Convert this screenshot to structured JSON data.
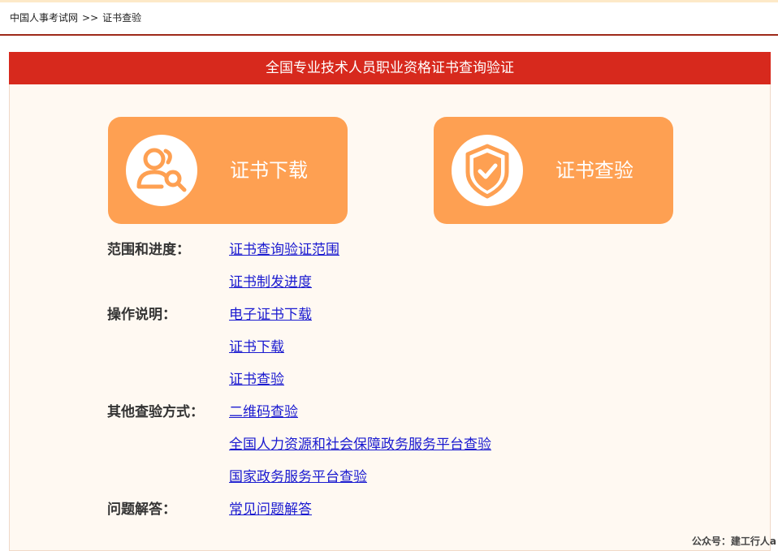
{
  "breadcrumb": {
    "home": "中国人事考试网",
    "separator": ">>",
    "current": "证书查验"
  },
  "panel": {
    "title": "全国专业技术人员职业资格证书查询验证"
  },
  "buttons": {
    "download": {
      "label": "证书下载",
      "icon": "user-search-icon"
    },
    "verify": {
      "label": "证书查验",
      "icon": "shield-check-icon"
    }
  },
  "sections": {
    "scope": {
      "label": "范围和进度：",
      "links": [
        "证书查询验证范围",
        "证书制发进度"
      ]
    },
    "instructions": {
      "label": "操作说明：",
      "links": [
        "电子证书下载",
        "证书下载",
        "证书查验"
      ]
    },
    "other": {
      "label": "其他查验方式：",
      "links": [
        "二维码查验",
        "全国人力资源和社会保障政务服务平台查验",
        "国家政务服务平台查验"
      ]
    },
    "faq": {
      "label": "问题解答：",
      "links": [
        "常见问题解答"
      ]
    }
  },
  "watermark": "公众号：建工行人a",
  "colors": {
    "title_bar": "#d7291d",
    "button": "#fea052",
    "link": "#1a1ad0",
    "panel_bg": "#fff9f2",
    "header_rule": "#9e2a1a"
  }
}
